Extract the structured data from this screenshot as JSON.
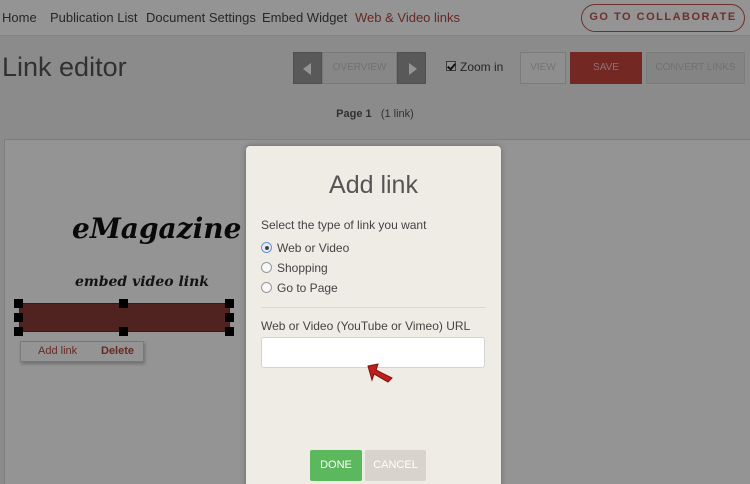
{
  "nav": {
    "items": [
      {
        "label": "Home"
      },
      {
        "label": "Publication List"
      },
      {
        "label": "Document Settings"
      },
      {
        "label": "Embed Widget"
      },
      {
        "label": "Web & Video links"
      }
    ],
    "collaborate_label": "GO TO COLLABORATE"
  },
  "header": {
    "title": "Link editor",
    "overview_label": "OVERVIEW",
    "zoom_label": "Zoom in",
    "zoom_checked": true,
    "view_label": "VIEW",
    "save_label": "SAVE",
    "convert_label": "CONVERT LINKS"
  },
  "page_info": {
    "page": "Page 1",
    "links": "(1 link)"
  },
  "canvas": {
    "title": "eMagazine",
    "subtitle": "embed video link",
    "popup": {
      "add_label": "Add link",
      "delete_label": "Delete"
    }
  },
  "dialog": {
    "title": "Add link",
    "instruction": "Select the type of link you want",
    "options": [
      {
        "label": "Web or Video",
        "checked": true
      },
      {
        "label": "Shopping",
        "checked": false
      },
      {
        "label": "Go to Page",
        "checked": false
      }
    ],
    "url_label": "Web or Video (YouTube or Vimeo) URL",
    "url_value": "",
    "url_placeholder": "",
    "done_label": "DONE",
    "cancel_label": "CANCEL"
  },
  "colors": {
    "accent": "#c6453f",
    "done": "#5cb85c",
    "link_box": "#8b3b38"
  }
}
